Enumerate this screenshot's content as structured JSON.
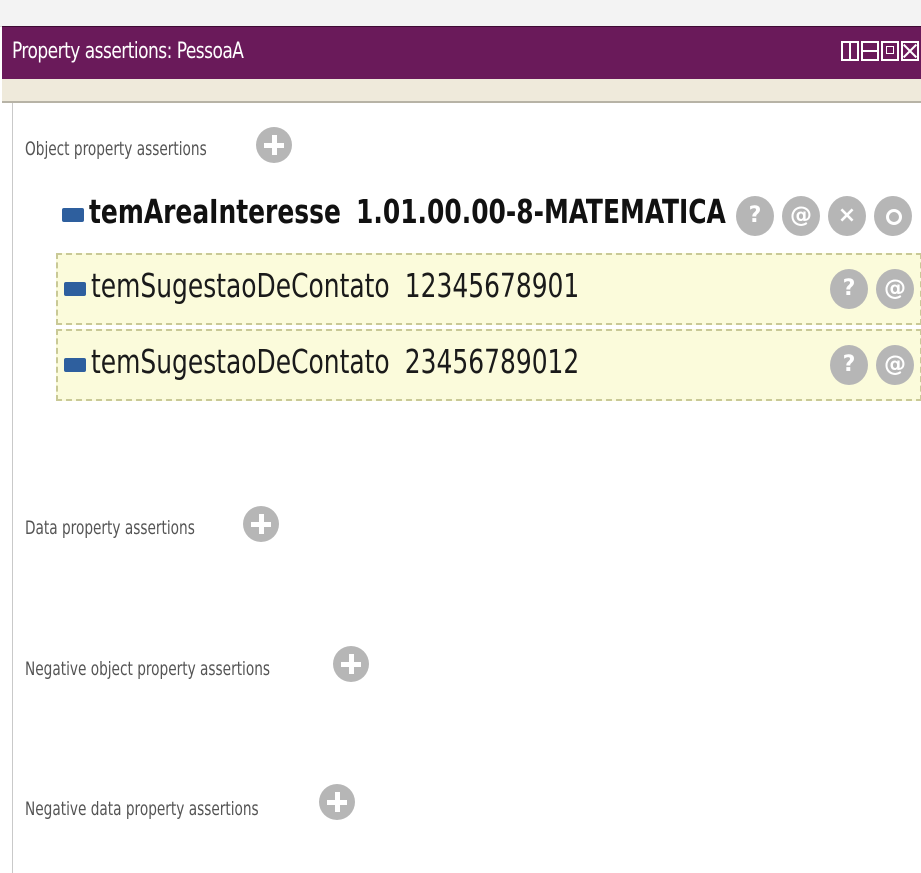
{
  "panel": {
    "title": "Property assertions: PessoaA",
    "icons": [
      "split-view-icon",
      "horizontal-split-icon",
      "maximize-icon",
      "close-icon"
    ]
  },
  "sections": {
    "object_property": {
      "label": "Object property assertions"
    },
    "data_property": {
      "label": "Data property assertions"
    },
    "negative_object_property": {
      "label": "Negative object property assertions"
    },
    "negative_data_property": {
      "label": "Negative data property assertions"
    }
  },
  "assertions": [
    {
      "property": "temAreaInteresse",
      "value": "1.01.00.00-8-MATEMATICA",
      "emphasis": true,
      "buttons": {
        "explain": "?",
        "annotate": "@",
        "delete": "×",
        "edit": ""
      }
    },
    {
      "property": "temSugestaoDeContato",
      "value": "12345678901",
      "emphasis": false,
      "inferred": true,
      "buttons": {
        "explain": "?",
        "annotate": "@"
      }
    },
    {
      "property": "temSugestaoDeContato",
      "value": "23456789012",
      "emphasis": false,
      "inferred": true,
      "buttons": {
        "explain": "?",
        "annotate": "@"
      }
    }
  ],
  "colors": {
    "title_bar": "#6a1a5a",
    "inferred_row_bg": "#fbfbdb",
    "property_bullet": "#2e5f9e",
    "button_gray": "#b6b6b6"
  }
}
